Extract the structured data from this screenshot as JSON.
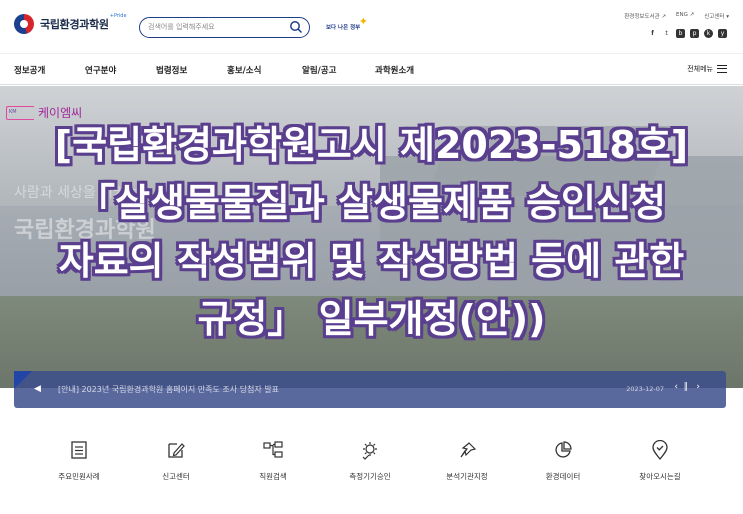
{
  "header": {
    "logo_text": "국립환경과학원",
    "logo_badge": "+Pride",
    "search_placeholder": "검색어를 입력해주세요",
    "slogan": "보다 나은 정부",
    "util_links": [
      "환경정보도서관 ↗",
      "ENG ↗",
      "신고센터 ▾"
    ],
    "sns_icons": [
      "f",
      "t",
      "b",
      "p",
      "k",
      "y"
    ]
  },
  "nav": {
    "items": [
      "정보공개",
      "연구분야",
      "법령정보",
      "홍보/소식",
      "알림/공고",
      "과학원소개"
    ],
    "all_menu": "전체메뉴"
  },
  "hero": {
    "brand_mark": "KM",
    "brand_name": "케이엠씨",
    "bg_text1": "사람과 세상을 지키는",
    "bg_text2": "국립환경과학원",
    "overlay_lines": [
      "[국립환경과학원고시 제2023-518호]",
      "「살생물물질과 살생물제품 승인신청",
      "자료의 작성범위 및 작성방법 등에 관한",
      "규정」 일부개정(안))"
    ]
  },
  "notice": {
    "text": "[안내] 2023년 국립환경과학원 홈페이지 만족도 조사 당첨자 발표",
    "date": "2023-12-07",
    "prev": "‹",
    "pause": "∥",
    "next": "›"
  },
  "quick_menu": [
    {
      "label": "주요민원사례",
      "icon": "document-list-icon"
    },
    {
      "label": "신고센터",
      "icon": "pencil-box-icon"
    },
    {
      "label": "직원검색",
      "icon": "org-chart-icon"
    },
    {
      "label": "측정기기승인",
      "icon": "gear-check-icon"
    },
    {
      "label": "분석기관지정",
      "icon": "pin-icon"
    },
    {
      "label": "환경데이터",
      "icon": "pie-chart-icon"
    },
    {
      "label": "찾아오시는길",
      "icon": "location-pin-icon"
    }
  ]
}
